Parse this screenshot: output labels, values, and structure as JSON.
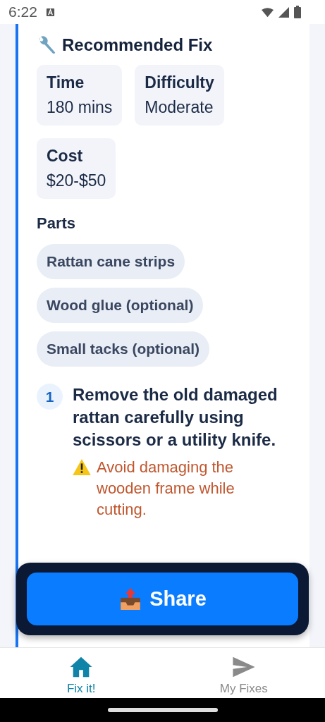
{
  "status_bar": {
    "time": "6:22"
  },
  "fix": {
    "title": "Recommended Fix",
    "stats": [
      {
        "label": "Time",
        "value": "180 mins"
      },
      {
        "label": "Difficulty",
        "value": "Moderate"
      },
      {
        "label": "Cost",
        "value": "$20-$50"
      }
    ],
    "parts_heading": "Parts",
    "parts": [
      "Rattan cane strips",
      "Wood glue (optional)",
      "Small tacks (optional)"
    ],
    "steps": [
      {
        "number": "1",
        "text": "Remove the old damaged rattan carefully using scissors or a utility knife.",
        "warning": "Avoid damaging the wooden frame while cutting."
      }
    ]
  },
  "share_button": {
    "label": "Share"
  },
  "bottom_nav": [
    {
      "label": "Fix it!",
      "selected": true
    },
    {
      "label": "My Fixes",
      "selected": false
    }
  ]
}
